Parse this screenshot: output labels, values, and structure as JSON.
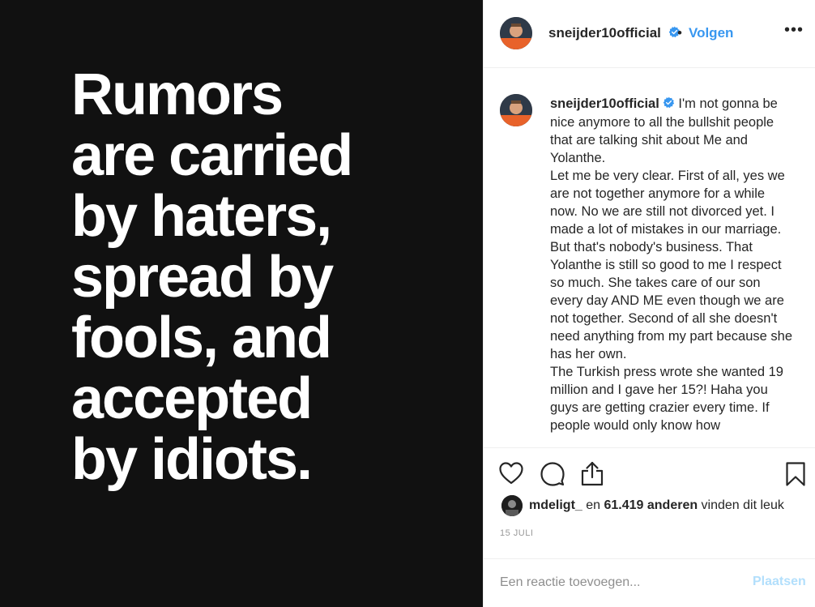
{
  "image": {
    "lines": [
      "Rumors",
      "are carried",
      "by haters,",
      "spread by",
      "fools, and",
      "accepted",
      "by idiots."
    ],
    "background_color": "#111111",
    "text_color": "#ffffff"
  },
  "header": {
    "username": "sneijder10official",
    "verified_icon": "verified-badge-icon",
    "separator": "•",
    "follow_label": "Volgen",
    "more_icon": "more-options-icon",
    "more_glyph": "•••"
  },
  "caption": {
    "username": "sneijder10official",
    "text": " I'm not gonna be nice anymore to all the bullshit people that are talking shit about Me and Yolanthe.\nLet me be very clear. First of all, yes we are not together anymore for a while now. No we are still not divorced yet. I made a lot of mistakes in our marriage. But that's nobody's business. That Yolanthe is still so good to me I respect so much. She takes care of our son every day AND ME even though we are not together. Second of all she doesn't need anything from my part because she has her own.\nThe Turkish press wrote she wanted 19 million and I gave her 15?! Haha you guys are getting crazier every time. If people would only know how"
  },
  "actions": {
    "like_icon": "heart-icon",
    "comment_icon": "comment-icon",
    "share_icon": "share-icon",
    "save_icon": "bookmark-icon"
  },
  "likes": {
    "user": "mdeligt_",
    "middle": " en ",
    "count": "61.419 anderen",
    "suffix": " vinden dit leuk"
  },
  "date": "15 JULI",
  "comment": {
    "placeholder": "Een reactie toevoegen...",
    "post_label": "Plaatsen"
  },
  "colors": {
    "accent": "#3897f0",
    "post_disabled": "#b2dffc",
    "muted": "#999999",
    "border": "#efefef"
  }
}
